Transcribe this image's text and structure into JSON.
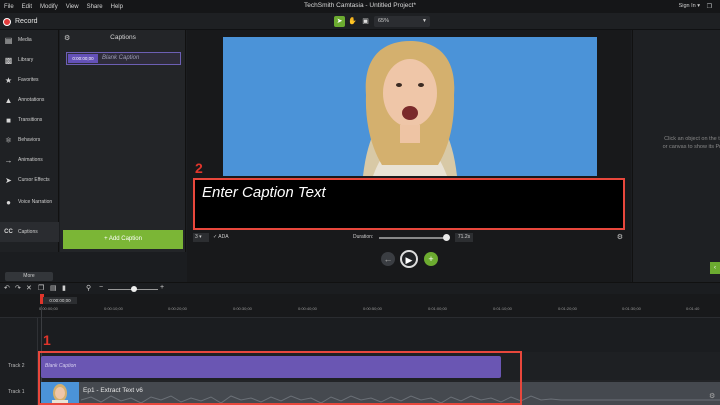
{
  "menubar": {
    "items": [
      "File",
      "Edit",
      "Modify",
      "View",
      "Share",
      "Help"
    ],
    "title": "TechSmith Camtasia - Untitled Project*",
    "sign_in": "Sign In ▾"
  },
  "toolbar": {
    "record_label": "Record",
    "zoom": "65%"
  },
  "sidebar": {
    "items": [
      {
        "label": "Media",
        "icon": "media-icon"
      },
      {
        "label": "Library",
        "icon": "library-icon"
      },
      {
        "label": "Favorites",
        "icon": "star-icon"
      },
      {
        "label": "Annotations",
        "icon": "annotations-icon"
      },
      {
        "label": "Transitions",
        "icon": "transitions-icon"
      },
      {
        "label": "Behaviors",
        "icon": "behaviors-icon"
      },
      {
        "label": "Animations",
        "icon": "animations-icon"
      },
      {
        "label": "Cursor Effects",
        "icon": "cursor-icon"
      },
      {
        "label": "Voice Narration",
        "icon": "microphone-icon"
      },
      {
        "label": "Captions",
        "icon": "cc-icon"
      }
    ],
    "more": "More"
  },
  "captions_panel": {
    "title": "Captions",
    "entry_time": "0:00:00;00",
    "entry_text": "Blank Caption",
    "add_button": "+ Add Caption"
  },
  "canvas": {
    "caption_text": "Enter Caption Text",
    "label_2": "2",
    "font_size": "3 ▾",
    "ada": "✓ ADA",
    "duration_label": "Duration:",
    "duration_value": "71.2s",
    "prev": "←",
    "play": "▶",
    "next": "+"
  },
  "properties": {
    "hint_line1": "Click an object on the ti",
    "hint_line2": "or canvas to show its Pr",
    "button": "‹"
  },
  "timeline": {
    "playhead_time": "0:00:00;00",
    "ticks": [
      "0:00:00;00",
      "0:00:10;00",
      "0:00:20;00",
      "0:00:30;00",
      "0:00:40;00",
      "0:00:50;00",
      "0:01:00;00",
      "0:01:10;00",
      "0:01:20;00",
      "0:01:30;00",
      "0:01:40"
    ],
    "track2_label": "Track 2",
    "track1_label": "Track 1",
    "caption_clip_label": "Blank Caption",
    "video_clip_label": "Ep1 - Extract Text v6",
    "label_1": "1"
  }
}
